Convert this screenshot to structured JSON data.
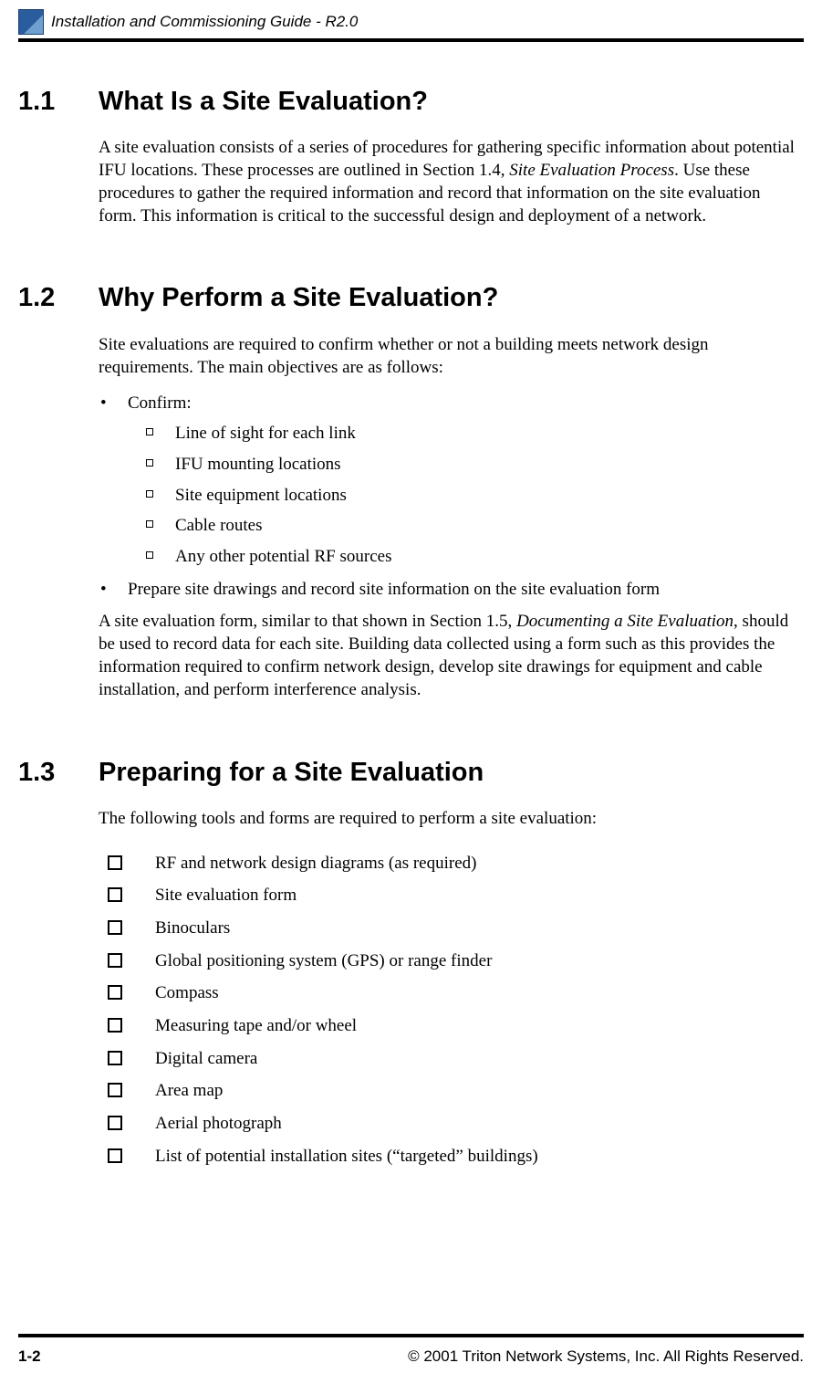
{
  "header": {
    "title": "Installation and Commissioning Guide - R2.0"
  },
  "sections": {
    "s11": {
      "num": "1.1",
      "heading": "What Is a Site Evaluation?",
      "p1a": "A site evaluation consists of a series of procedures for gathering specific information about potential IFU locations. These processes are outlined in Section 1.4, ",
      "p1b": "Site Evaluation Process",
      "p1c": ". Use these procedures to gather the required information and record that information on the site evaluation form. This information is critical to the successful design and deployment of a network."
    },
    "s12": {
      "num": "1.2",
      "heading": "Why Perform a Site Evaluation?",
      "p1": "Site evaluations are required to confirm whether or not a building meets network design requirements. The main objectives are as follows:",
      "bullets": {
        "b1": "Confirm:",
        "sub": [
          "Line of sight for each link",
          "IFU mounting locations",
          "Site equipment locations",
          "Cable routes",
          "Any other potential RF sources"
        ],
        "b2": "Prepare site drawings and record site information on the site evaluation form"
      },
      "p2a": "A site evaluation form, similar to that shown in Section 1.5, ",
      "p2b": "Documenting a Site Evaluation",
      "p2c": ", should be used to record data for each site. Building data collected using a form such as this provides the information required to confirm network design, develop site drawings for equipment and cable installation, and perform interference analysis."
    },
    "s13": {
      "num": "1.3",
      "heading": "Preparing for a Site Evaluation",
      "p1": "The following tools and forms are required to perform a site evaluation:",
      "checklist": [
        "RF and network design diagrams (as required)",
        "Site evaluation form",
        "Binoculars",
        "Global positioning system (GPS) or range finder",
        "Compass",
        "Measuring tape and/or wheel",
        "Digital camera",
        "Area map",
        "Aerial photograph",
        "List of potential installation sites (“targeted” buildings)"
      ]
    }
  },
  "footer": {
    "page_num": "1-2",
    "copyright": "© 2001 Triton Network Systems, Inc. All Rights Reserved."
  }
}
